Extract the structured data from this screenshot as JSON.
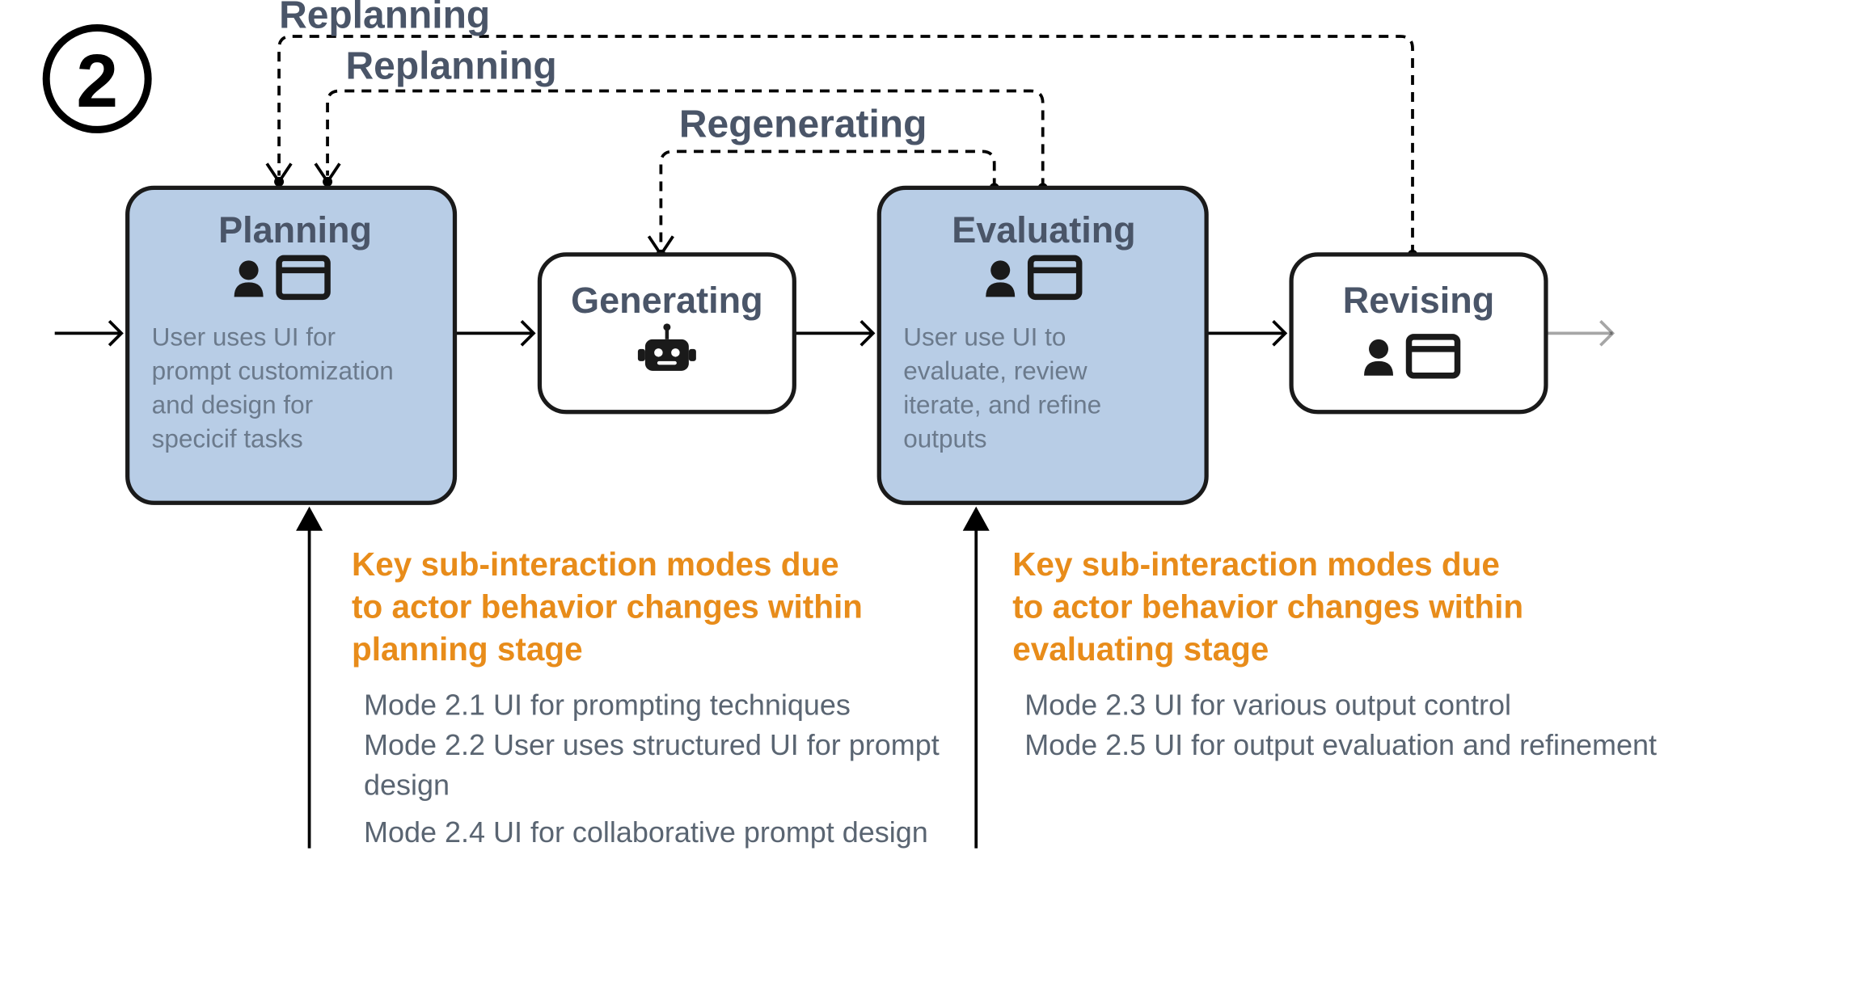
{
  "badge": "2",
  "loops": {
    "replan_top": "Replanning",
    "replan_mid": "Replanning",
    "regen": "Regenerating"
  },
  "stages": {
    "planning": {
      "title": "Planning",
      "desc1": "User uses UI for",
      "desc2": "prompt customization",
      "desc3": "and design for",
      "desc4": "specicif tasks"
    },
    "generating": {
      "title": "Generating"
    },
    "evaluating": {
      "title": "Evaluating",
      "desc1": "User use UI to",
      "desc2": "evaluate, review",
      "desc3": "iterate, and refine",
      "desc4": "outputs"
    },
    "revising": {
      "title": "Revising"
    }
  },
  "annotations": {
    "left": {
      "t1": "Key sub-interaction modes due",
      "t2": "to actor behavior changes within",
      "t3": "planning stage",
      "items": [
        "Mode 2.1 UI for prompting techniques",
        "Mode 2.2 User uses structured UI for prompt",
        "design",
        "Mode 2.4 UI for collaborative prompt design"
      ]
    },
    "right": {
      "t1": "Key sub-interaction modes due",
      "t2": "to actor behavior changes within",
      "t3": "evaluating stage",
      "items": [
        "Mode 2.3 UI for various output control",
        "Mode 2.5 UI for output evaluation and refinement"
      ]
    }
  }
}
